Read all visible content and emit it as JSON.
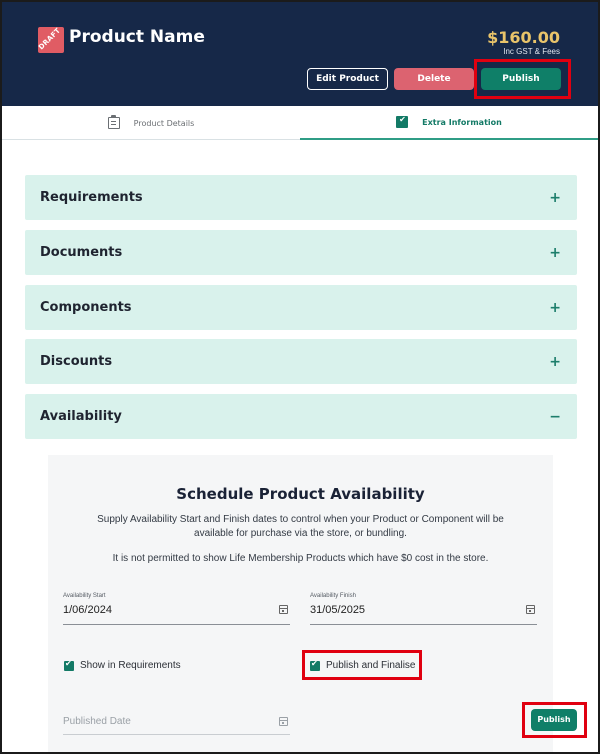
{
  "header": {
    "badge": "DRAFT",
    "product_name": "Product Name",
    "price": "$160.00",
    "price_note": "Inc GST & Fees",
    "buttons": {
      "edit": "Edit Product",
      "delete": "Delete",
      "publish": "Publish"
    }
  },
  "tabs": [
    {
      "label": "Product Details",
      "icon": "clipboard-icon",
      "active": false
    },
    {
      "label": "Extra Information",
      "icon": "checklist-icon",
      "active": true
    }
  ],
  "accordion": [
    {
      "title": "Requirements",
      "sign": "+"
    },
    {
      "title": "Documents",
      "sign": "+"
    },
    {
      "title": "Components",
      "sign": "+"
    },
    {
      "title": "Discounts",
      "sign": "+"
    },
    {
      "title": "Availability",
      "sign": "−"
    }
  ],
  "availability": {
    "title": "Schedule Product Availability",
    "description": "Supply Availability Start and Finish dates to control when your Product or Component will be available for purchase via the store, or bundling.",
    "note": "It is not permitted to show Life Membership Products which have $0 cost in the store.",
    "start": {
      "label": "Availability Start",
      "value": "1/06/2024"
    },
    "finish": {
      "label": "Availability Finish",
      "value": "31/05/2025"
    },
    "show_in_requirements": {
      "label": "Show in Requirements",
      "checked": true
    },
    "publish_and_finalise": {
      "label": "Publish and Finalise",
      "checked": true
    },
    "published_date": {
      "placeholder": "Published Date"
    },
    "publish_button": "Publish"
  },
  "colors": {
    "header_bg": "#162848",
    "accent_green": "#0f7f68",
    "delete_red": "#dc6370",
    "price_gold": "#e9c46a",
    "accordion_bg": "#d9f2ec",
    "highlight_red": "#e00010"
  }
}
